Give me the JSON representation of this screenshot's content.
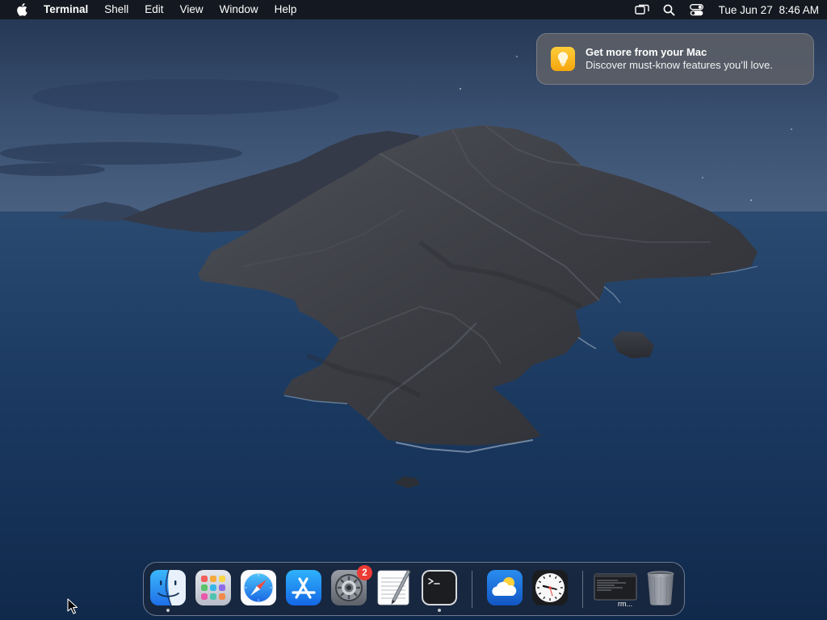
{
  "menubar": {
    "app_name": "Terminal",
    "menus": [
      "Shell",
      "Edit",
      "View",
      "Window",
      "Help"
    ],
    "status_icons": [
      "screen-mirroring-icon",
      "spotlight-search-icon",
      "control-center-icon"
    ],
    "date": "Tue Jun 27",
    "time": "8:46 AM"
  },
  "notification": {
    "title": "Get more from your Mac",
    "body": "Discover must-know features you’ll love.",
    "icon": "lightbulb-icon",
    "icon_color": "#f7b51a"
  },
  "dock": {
    "apps": [
      {
        "name": "Finder",
        "icon": "finder-icon",
        "running": true
      },
      {
        "name": "Launchpad",
        "icon": "launchpad-icon",
        "running": false
      },
      {
        "name": "Safari",
        "icon": "safari-icon",
        "running": false
      },
      {
        "name": "App Store",
        "icon": "app-store-icon",
        "running": false
      },
      {
        "name": "System Settings",
        "icon": "system-settings-icon",
        "running": false,
        "badge": "2"
      },
      {
        "name": "TextEdit",
        "icon": "textedit-icon",
        "running": false
      },
      {
        "name": "Terminal",
        "icon": "terminal-icon",
        "running": true
      },
      {
        "name": "Weather",
        "icon": "weather-icon",
        "running": false
      },
      {
        "name": "Clock",
        "icon": "clock-icon",
        "running": false
      }
    ],
    "minimized_window": {
      "label": "rm...",
      "icon": "minimized-terminal-window-icon"
    },
    "trash": {
      "name": "Trash",
      "icon": "trash-icon"
    }
  },
  "colors": {
    "badge": "#ec3b35",
    "menubar_bg": "#14161c",
    "wallpaper_sea": "#173459",
    "wallpaper_sky": "#33496a"
  }
}
